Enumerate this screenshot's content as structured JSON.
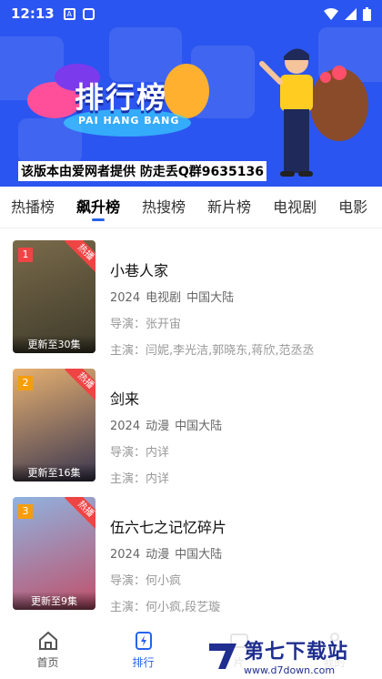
{
  "status_bar": {
    "time": "12:13"
  },
  "banner": {
    "title": "排行榜",
    "subtitle": "PAI HANG BANG",
    "notice": "该版本由爱网者提供 防走丢Q群9635136"
  },
  "tabs": [
    {
      "label": "热播榜"
    },
    {
      "label": "飙升榜"
    },
    {
      "label": "热搜榜"
    },
    {
      "label": "新片榜"
    },
    {
      "label": "电视剧"
    },
    {
      "label": "电影"
    }
  ],
  "items": [
    {
      "rank": "1",
      "badge": "热播",
      "update": "更新至30集",
      "title": "小巷人家",
      "year": "2024",
      "type": "电视剧",
      "region": "中国大陆",
      "director": "导演：张开宙",
      "cast": "主演：闫妮,李光洁,郭晓东,蒋欣,范丞丞",
      "rank_color": "#ef4444",
      "poster_colors": [
        "#7a6a4a",
        "#3d3a2a"
      ]
    },
    {
      "rank": "2",
      "badge": "热播",
      "update": "更新至16集",
      "title": "剑来",
      "year": "2024",
      "type": "动漫",
      "region": "中国大陆",
      "director": "导演：内详",
      "cast": "主演：内详",
      "rank_color": "#f59e0b",
      "poster_colors": [
        "#e6b070",
        "#3a3650"
      ]
    },
    {
      "rank": "3",
      "badge": "热播",
      "update": "更新至9集",
      "title": "伍六七之记忆碎片",
      "year": "2024",
      "type": "动漫",
      "region": "中国大陆",
      "director": "导演：何小疯",
      "cast": "主演：何小疯,段艺璇",
      "rank_color": "#f59e0b",
      "poster_colors": [
        "#8fb3e0",
        "#c0506a"
      ]
    }
  ],
  "nav": [
    {
      "label": "首页",
      "icon": "home-icon"
    },
    {
      "label": "排行",
      "icon": "rank-icon"
    },
    {
      "label": "片",
      "icon": "film-icon"
    },
    {
      "label": "我的",
      "icon": "user-icon"
    }
  ],
  "watermark": {
    "name": "第七下载站",
    "url": "www.d7down.com"
  },
  "colors": {
    "accent": "#2563eb",
    "banner": "#2b55f0"
  }
}
